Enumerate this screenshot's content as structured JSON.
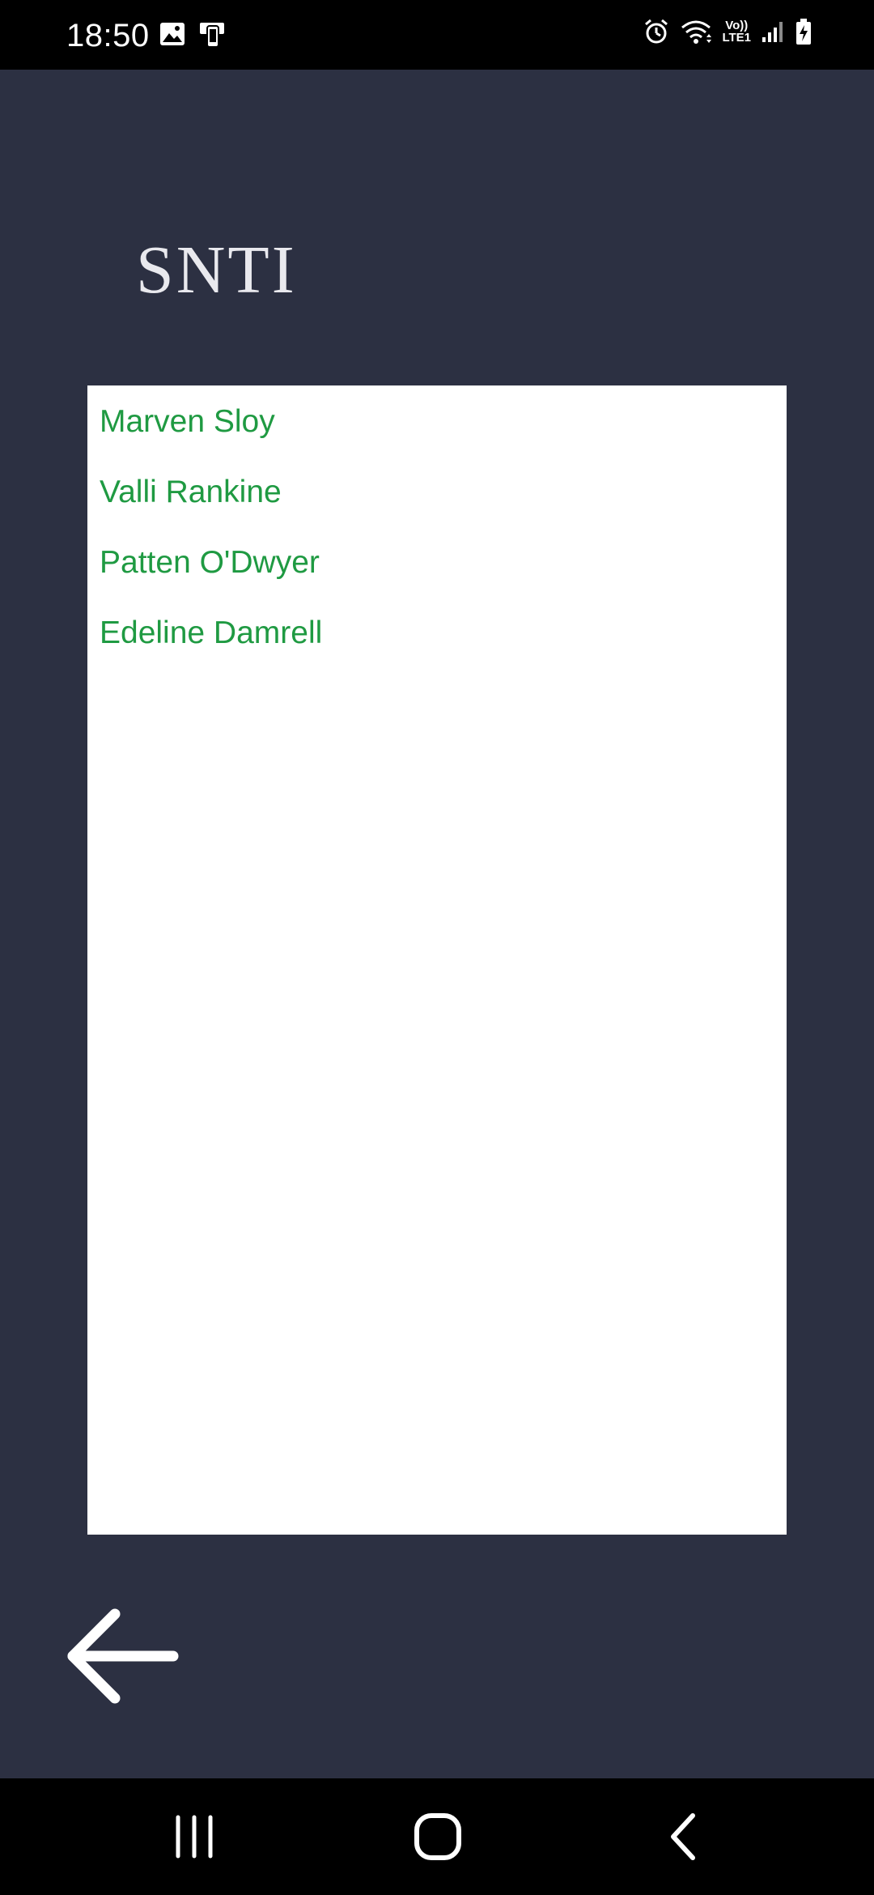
{
  "status_bar": {
    "time": "18:50",
    "left_icons": [
      "gallery-icon",
      "phone-transfer-icon"
    ],
    "right_icons": [
      "alarm-icon",
      "wifi-icon",
      "volte-icon",
      "signal-icon",
      "battery-charging-icon"
    ],
    "volte_label_top": "Vo))",
    "volte_label_bottom": "LTE1"
  },
  "app": {
    "logo_text": "SNTI"
  },
  "list": {
    "items": [
      "Marven Sloy",
      "Valli Rankine",
      "Patten O'Dwyer",
      "Edeline Damrell"
    ]
  },
  "colors": {
    "background": "#2c3042",
    "panel": "#ffffff",
    "item_text": "#1f9a42"
  },
  "footer": {
    "back_icon": "arrow-left-icon"
  },
  "nav_bar": {
    "buttons": [
      "recent-apps-icon",
      "home-icon",
      "back-icon"
    ]
  }
}
